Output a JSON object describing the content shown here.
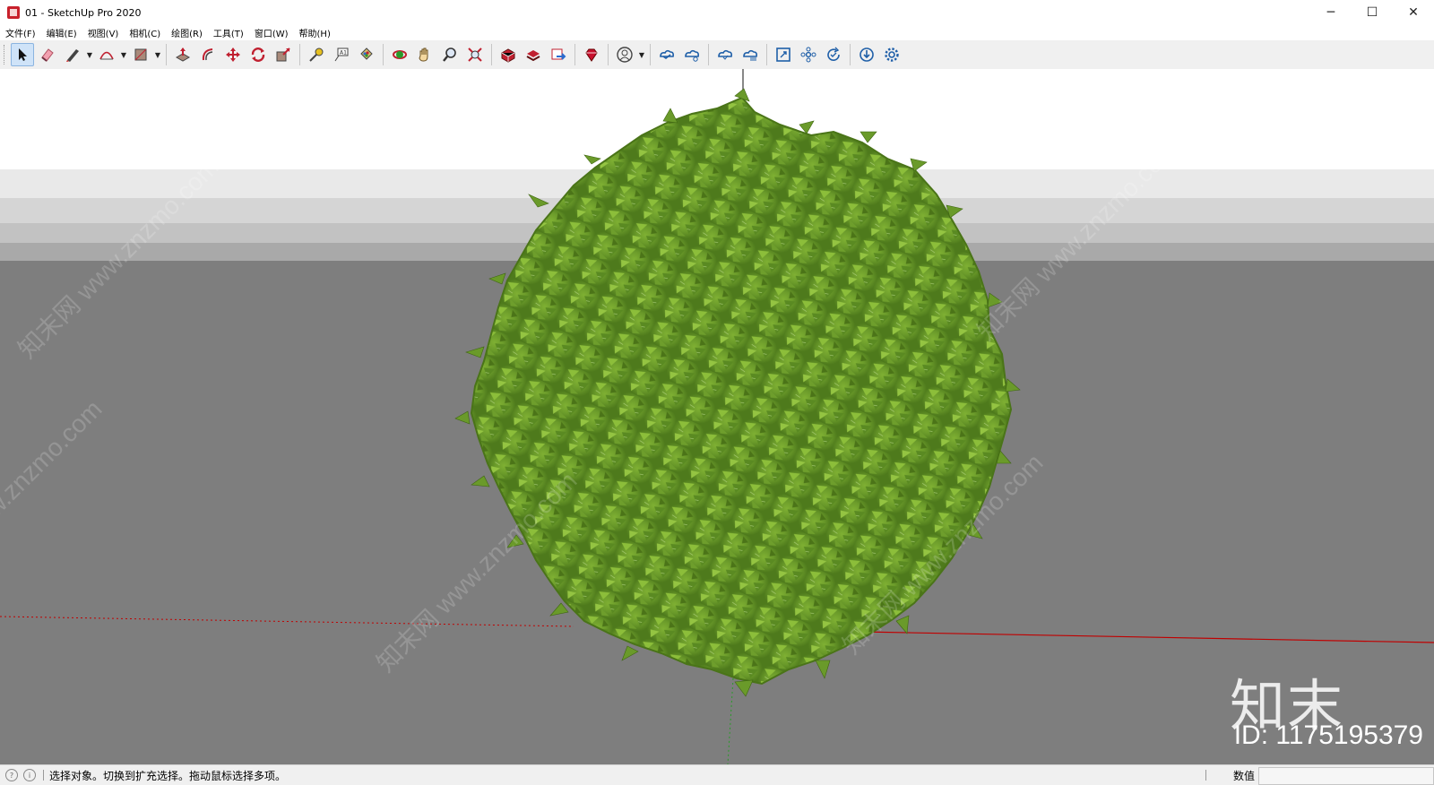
{
  "window": {
    "title": "01 - SketchUp Pro 2020",
    "controls": {
      "minimize": "─",
      "maximize": "☐",
      "close": "✕"
    }
  },
  "menu": {
    "items": [
      "文件(F)",
      "编辑(E)",
      "视图(V)",
      "相机(C)",
      "绘图(R)",
      "工具(T)",
      "窗口(W)",
      "帮助(H)"
    ]
  },
  "toolbar": {
    "active_tool": "select-tool",
    "tools": [
      "select-tool",
      "eraser-tool",
      "line-tool",
      "arc-tool",
      "rectangle-tool",
      "push-pull-tool",
      "offset-tool",
      "move-tool",
      "rotate-tool",
      "scale-tool",
      "tape-measure-tool",
      "text-tool",
      "paint-bucket-tool",
      "orbit-tool",
      "pan-tool",
      "zoom-tool",
      "zoom-extents-tool",
      "3d-warehouse-icon",
      "extension-warehouse-icon",
      "send-to-layout-icon",
      "ruby-console-icon",
      "account-icon",
      "trimble-connect-icon",
      "trimble-connect-share-icon",
      "cloud-sync-icon",
      "cloud-upload-icon",
      "scene-expand-icon",
      "components-icon",
      "refresh-icon",
      "download-icon",
      "settings-icon"
    ]
  },
  "viewport": {
    "colors": {
      "sky": "#ffffff",
      "ground": "#7e7e7e",
      "foliage": "#6a9a2a",
      "red_axis": "#c00000",
      "green_axis": "#2a9a2a"
    },
    "watermark_text": "知末网 www.znzmo.com",
    "logo_text": "知末",
    "id_text": "ID: 1175195379"
  },
  "statusbar": {
    "message": "选择对象。切换到扩充选择。拖动鼠标选择多项。",
    "measurements_label": "数值",
    "measurements_value": ""
  }
}
